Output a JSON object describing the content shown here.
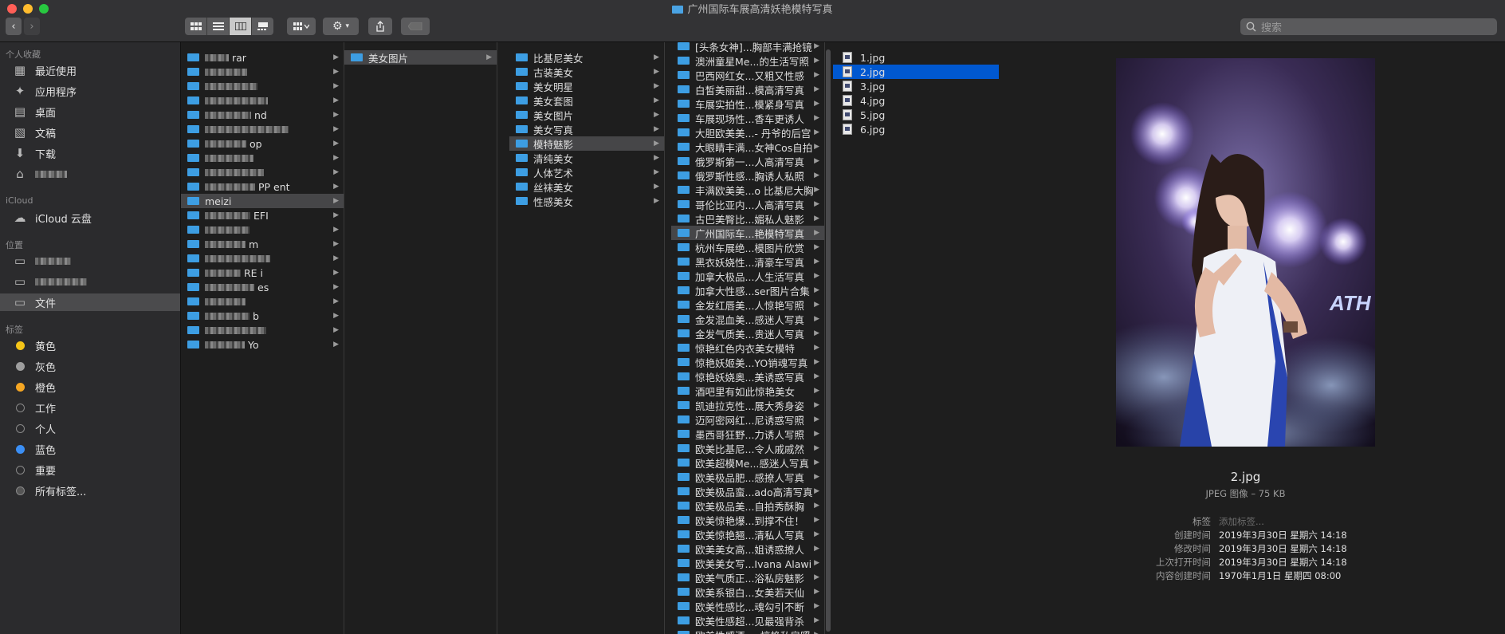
{
  "window": {
    "title": "广州国际车展高清妖艳模特写真",
    "search_placeholder": "搜索"
  },
  "sidebar": {
    "favorites_header": "个人收藏",
    "favorites": [
      {
        "label": "最近使用",
        "icon": "recents-icon"
      },
      {
        "label": "应用程序",
        "icon": "applications-icon"
      },
      {
        "label": "桌面",
        "icon": "desktop-icon"
      },
      {
        "label": "文稿",
        "icon": "documents-icon"
      },
      {
        "label": "下载",
        "icon": "downloads-icon"
      }
    ],
    "icloud_header": "iCloud",
    "icloud": [
      {
        "label": "iCloud 云盘",
        "icon": "cloud-icon"
      }
    ],
    "locations_header": "位置",
    "locations": [
      {
        "label": "",
        "icon": "disk-icon"
      },
      {
        "label": "",
        "icon": "disk-icon"
      },
      {
        "label": "文件",
        "icon": "disk-icon"
      }
    ],
    "tags_header": "标签",
    "tags": [
      {
        "label": "黄色",
        "color": "#f5c518"
      },
      {
        "label": "灰色",
        "color": "#9e9e9e"
      },
      {
        "label": "橙色",
        "color": "#f5a623"
      },
      {
        "label": "工作",
        "color": ""
      },
      {
        "label": "个人",
        "color": ""
      },
      {
        "label": "蓝色",
        "color": "#3b8ff5"
      },
      {
        "label": "重要",
        "color": ""
      },
      {
        "label": "所有标签...",
        "color": ""
      }
    ]
  },
  "columns": {
    "col1": [
      "rar",
      "",
      "",
      "",
      "nd",
      "",
      "op",
      "",
      "",
      "PP    ent",
      "meizi",
      "EFI",
      "",
      "m",
      "",
      "RE    i",
      "es",
      "",
      "b",
      "",
      "Yo"
    ],
    "col1_selected": 10,
    "col2": [
      "美女图片"
    ],
    "col2_selected": 0,
    "col3": [
      "比基尼美女",
      "古装美女",
      "美女明星",
      "美女套图",
      "美女图片",
      "美女写真",
      "模特魅影",
      "清纯美女",
      "人体艺术",
      "丝袜美女",
      "性感美女"
    ],
    "col3_selected": 6,
    "col4": [
      "[头条女神]...胸部丰满抢镜",
      "澳洲童星Me...的生活写照",
      "巴西网红女...又粗又性感",
      "白皙美丽甜...模高清写真",
      "车展实拍性...模紧身写真",
      "车展现场性...香车更诱人",
      "大胆欧美美...- 丹爷的后宫",
      "大眼睛丰满...女神Cos自拍",
      "俄罗斯第一...人高清写真",
      "俄罗斯性感...胸诱人私照",
      "丰满欧美美...o 比基尼大胸",
      "哥伦比亚内...人高清写真",
      "古巴美臀比...媚私人魅影",
      "广州国际车...艳模特写真",
      "杭州车展绝...模图片欣赏",
      "黑衣妖娆性...清豪车写真",
      "加拿大极品...人生活写真",
      "加拿大性感...ser图片合集",
      "金发红唇美...人惊艳写照",
      "金发混血美...感迷人写真",
      "金发气质美...贵迷人写真",
      "惊艳红色内衣美女模特",
      "惊艳妖姬美...YO销魂写真",
      "惊艳妖娆奥...美诱惑写真",
      "酒吧里有如此惊艳美女",
      "凯迪拉克性...展大秀身姿",
      "迈阿密网红...尼诱惑写照",
      "墨西哥狂野...力诱人写照",
      "欧美比基尼...令人戚戚然",
      "欧美超模Me...感迷人写真",
      "欧美极品肥...感撩人写真",
      "欧美极品蛮...ado高清写真",
      "欧美极品美...自拍秀酥胸",
      "欧美惊艳爆...到撑不住！",
      "欧美惊艳翘...清私人写真",
      "欧美美女高...姐诱惑撩人",
      "欧美美女写...Ivana Alawi",
      "欧美气质正...浴私房魅影",
      "欧美系银白...女美若天仙",
      "欧美性感比...魂勾引不断",
      "欧美性感超...见最强背杀",
      "欧美性感酒...y惊艳私房照"
    ],
    "col4_selected": 13,
    "col5": [
      "1.jpg",
      "2.jpg",
      "3.jpg",
      "4.jpg",
      "5.jpg",
      "6.jpg"
    ],
    "col5_selected": 1
  },
  "preview": {
    "file_name": "2.jpg",
    "file_kind": "JPEG 图像 – 75 KB",
    "meta": [
      {
        "key": "标签",
        "value": "添加标签..."
      },
      {
        "key": "创建时间",
        "value": "2019年3月30日 星期六 14:18"
      },
      {
        "key": "修改时间",
        "value": "2019年3月30日 星期六 14:18"
      },
      {
        "key": "上次打开时间",
        "value": "2019年3月30日 星期六 14:18"
      },
      {
        "key": "内容创建时间",
        "value": "1970年1月1日 星期四 08:00"
      }
    ]
  }
}
